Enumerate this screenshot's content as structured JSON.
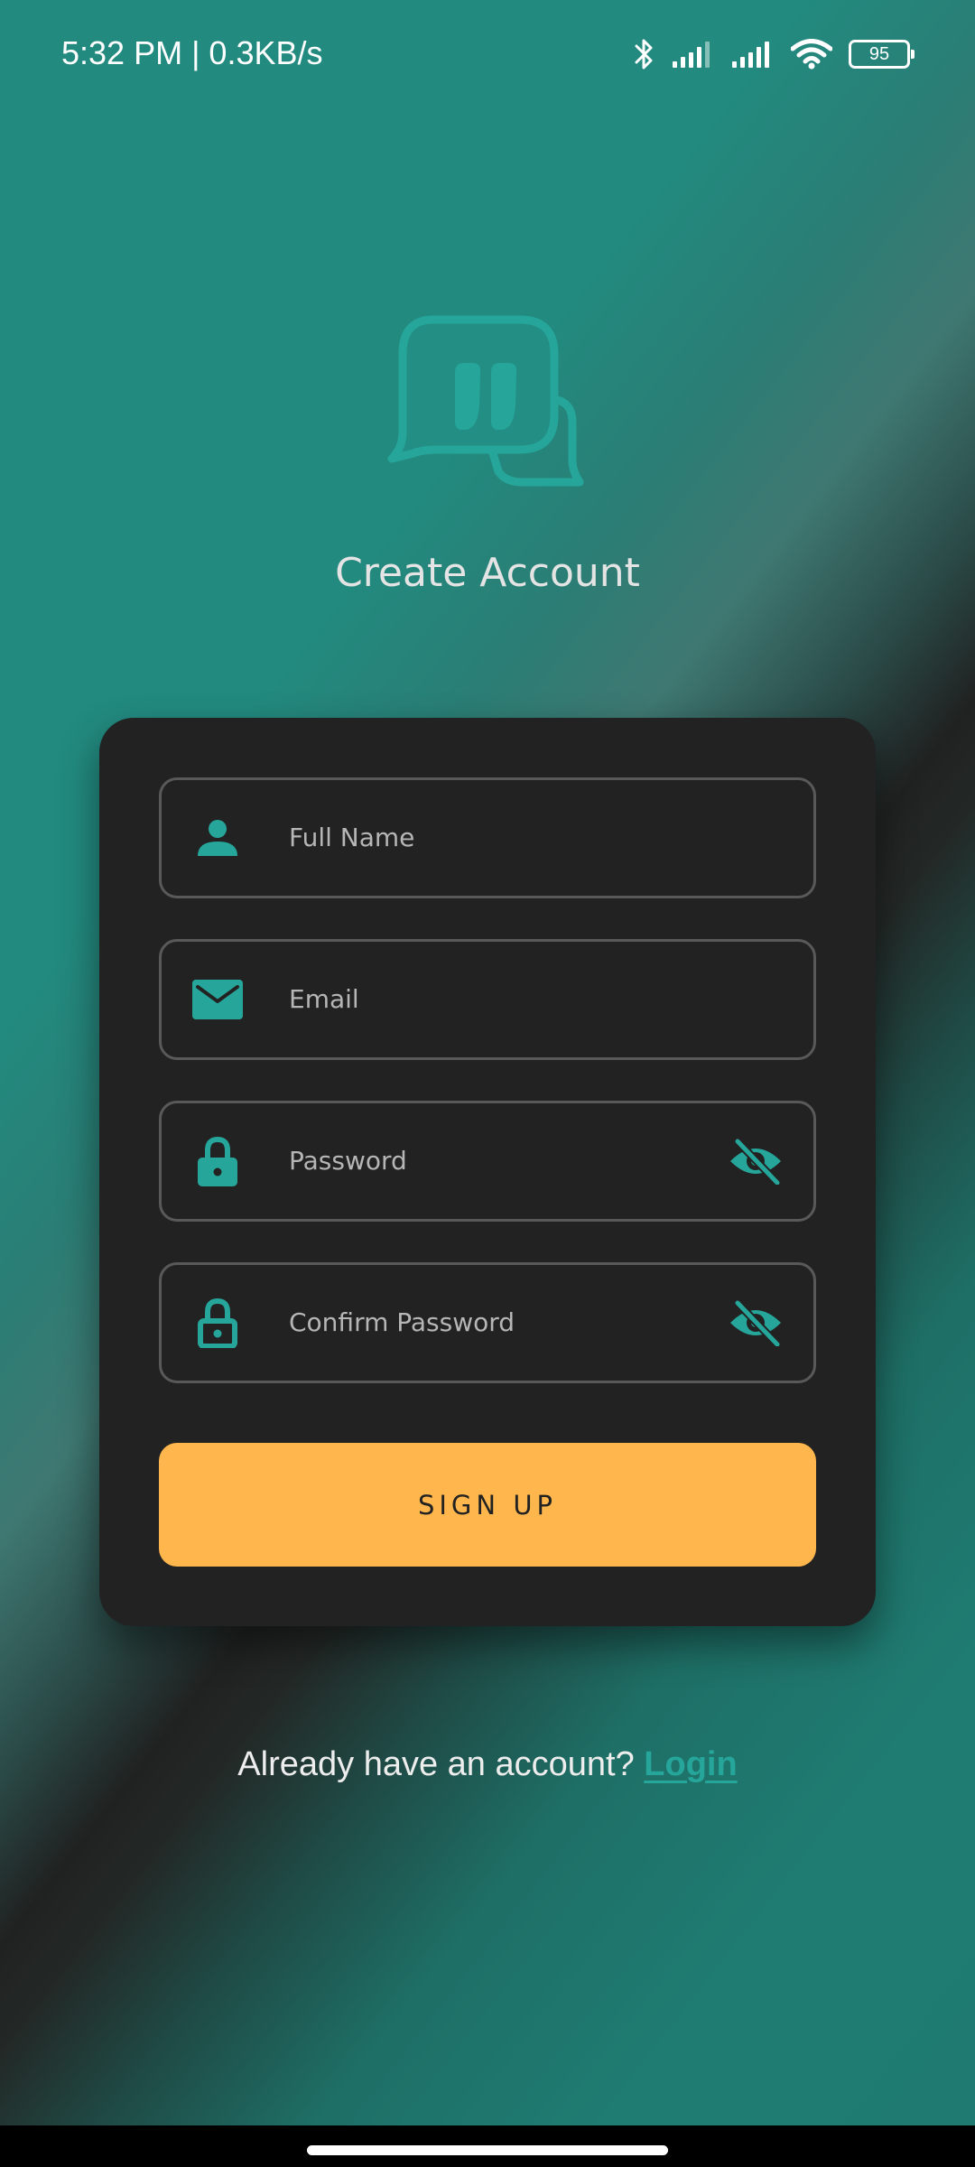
{
  "status_bar": {
    "time": "5:32 PM | 0.3KB/s",
    "battery": "95",
    "icons": [
      "bluetooth-icon",
      "signal-icon",
      "signal-icon",
      "wifi-icon",
      "battery-icon"
    ]
  },
  "header": {
    "logo_icon": "chat-bubbles-icon",
    "title": "Create Account"
  },
  "form": {
    "full_name": {
      "placeholder": "Full Name",
      "icon": "person-icon"
    },
    "email": {
      "placeholder": "Email",
      "icon": "envelope-icon"
    },
    "password": {
      "placeholder": "Password",
      "icon": "lock-icon",
      "toggle_icon": "eye-off-icon"
    },
    "confirm_password": {
      "placeholder": "Confirm Password",
      "icon": "lock-outline-icon",
      "toggle_icon": "eye-off-icon"
    },
    "submit_label": "SIGN UP"
  },
  "footer": {
    "prompt": "Already have an account? ",
    "login_label": "Login"
  },
  "colors": {
    "accent": "#26a69a",
    "button": "#ffb74d",
    "card": "#222222",
    "background": "#228a7f"
  }
}
